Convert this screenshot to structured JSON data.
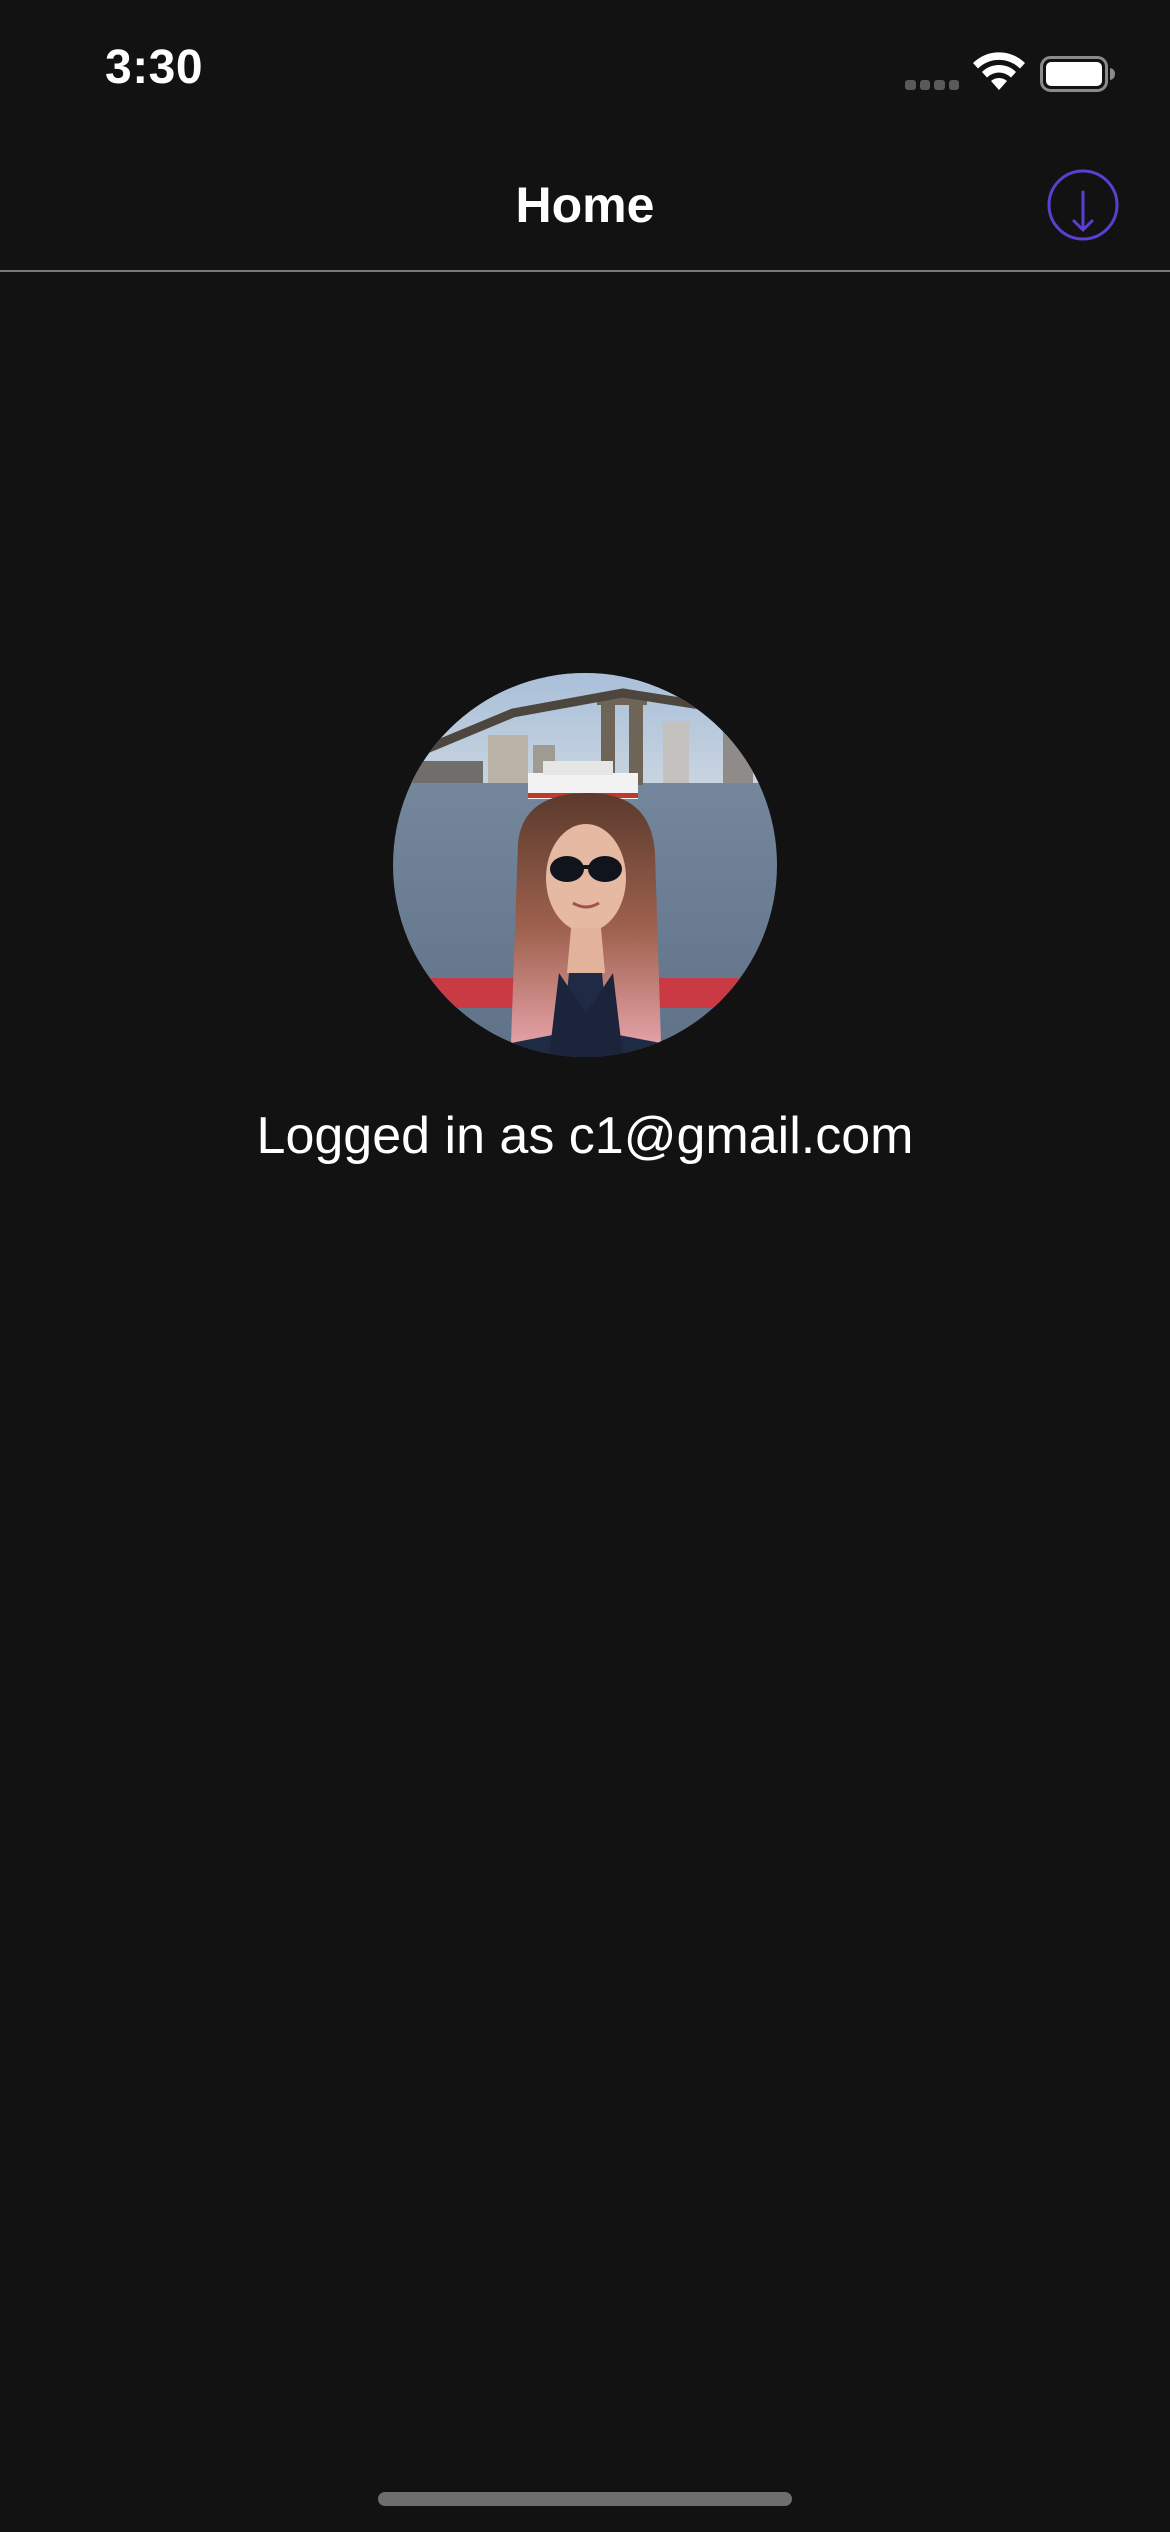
{
  "status_bar": {
    "time": "3:30",
    "icons": [
      "cellular-signal-icon",
      "wifi-icon",
      "battery-icon"
    ]
  },
  "nav_bar": {
    "title": "Home",
    "right_action_icon": "download-icon"
  },
  "profile": {
    "status_text": "Logged in as c1@gmail.com",
    "avatar": "profile-photo"
  },
  "colors": {
    "background": "#121212",
    "accent": "#5b3fd1",
    "text": "#ffffff",
    "separator": "#7a7a7a"
  }
}
